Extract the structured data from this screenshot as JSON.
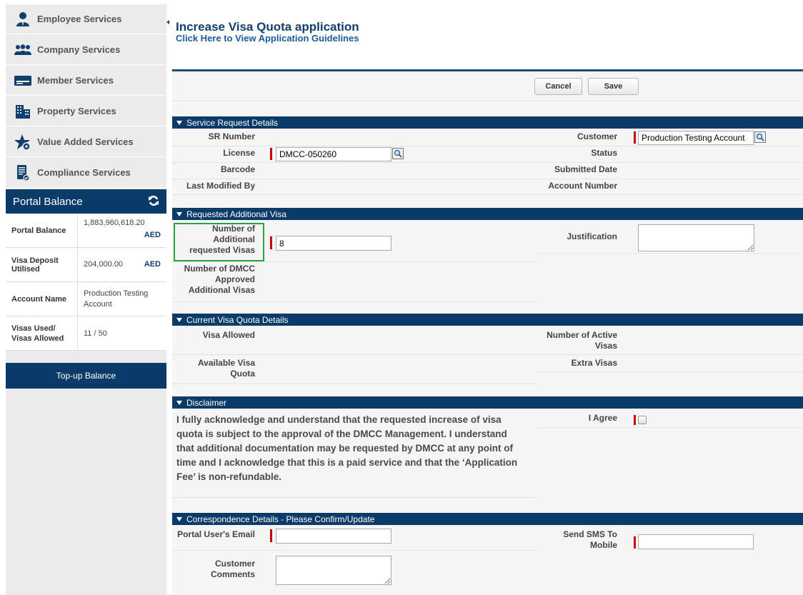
{
  "sidebar": {
    "items": [
      {
        "label": "Employee Services",
        "icon": "employee-icon"
      },
      {
        "label": "Company Services",
        "icon": "company-icon"
      },
      {
        "label": "Member Services",
        "icon": "member-card-icon"
      },
      {
        "label": "Property Services",
        "icon": "building-icon"
      },
      {
        "label": "Value Added Services",
        "icon": "star-gear-icon"
      },
      {
        "label": "Compliance Services",
        "icon": "compliance-document-icon"
      }
    ]
  },
  "balance": {
    "title": "Portal Balance",
    "rows": [
      {
        "label": "Portal Balance",
        "value": "1,883,960,618.20",
        "currency": "AED"
      },
      {
        "label": "Visa Deposit Utilised",
        "value": "204,000.00",
        "currency": "AED"
      },
      {
        "label": "Account Name",
        "value": "Production Testing Account"
      },
      {
        "label": "Visas Used/ Visas Allowed",
        "value": "11 / 50"
      }
    ],
    "topup_label": "Top-up Balance"
  },
  "page": {
    "title": "Increase Visa Quota application",
    "guidelines_link": "Click Here to View Application Guidelines"
  },
  "buttons": {
    "cancel": "Cancel",
    "save": "Save"
  },
  "sections": {
    "service_request": {
      "title": "Service Request Details",
      "sr_number_label": "SR Number",
      "license_label": "License",
      "license_value": "DMCC-050260",
      "barcode_label": "Barcode",
      "last_modified_label": "Last Modified By",
      "customer_label": "Customer",
      "customer_value": "Production Testing Account",
      "status_label": "Status",
      "submitted_date_label": "Submitted Date",
      "account_number_label": "Account Number"
    },
    "requested_visa": {
      "title": "Requested Additional Visa",
      "num_additional_label": "Number of Additional requested Visas",
      "num_additional_value": "8",
      "num_approved_label": "Number of DMCC Approved Additional Visas",
      "justification_label": "Justification"
    },
    "current_quota": {
      "title": "Current Visa Quota Details",
      "visa_allowed_label": "Visa Allowed",
      "available_quota_label": "Available Visa Quota",
      "active_visas_label": "Number of Active Visas",
      "extra_visas_label": "Extra Visas"
    },
    "disclaimer": {
      "title": "Disclaimer",
      "text": "I fully acknowledge and understand that the requested increase of visa quota is subject to the approval of the DMCC Management. I understand that additional documentation may be requested by DMCC at any point of time and I acknowledge that this is a paid service and that the ‘Application Fee’ is non-refundable.",
      "agree_label": "I Agree"
    },
    "correspondence": {
      "title": "Correspondence Details - Please Confirm/Update",
      "email_label": "Portal User's Email",
      "comments_label": "Customer Comments",
      "sms_label": "Send SMS To Mobile"
    }
  },
  "colors": {
    "primary": "#0b3b68",
    "link": "#1d5b96",
    "required": "#cc0000",
    "highlight": "#2aa23c"
  }
}
